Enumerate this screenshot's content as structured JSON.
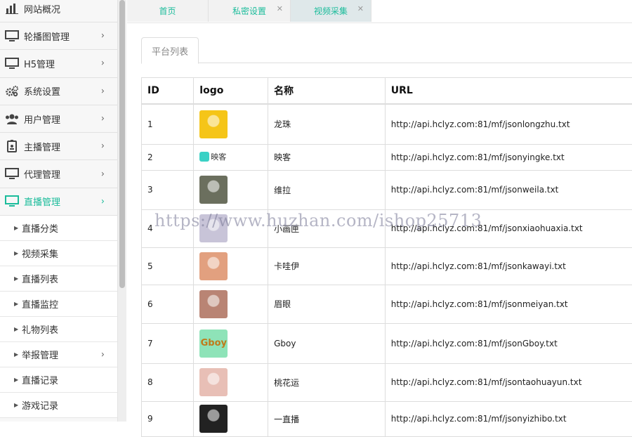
{
  "sidebar": {
    "items": [
      {
        "label": "网站概况",
        "icon": "bar-chart-icon",
        "has_arrow": false
      },
      {
        "label": "轮播图管理",
        "icon": "monitor-icon",
        "has_arrow": true
      },
      {
        "label": "H5管理",
        "icon": "monitor-icon",
        "has_arrow": true
      },
      {
        "label": "系统设置",
        "icon": "gears-icon",
        "has_arrow": true
      },
      {
        "label": "用户管理",
        "icon": "users-icon",
        "has_arrow": true
      },
      {
        "label": "主播管理",
        "icon": "id-badge-icon",
        "has_arrow": true
      },
      {
        "label": "代理管理",
        "icon": "monitor-icon",
        "has_arrow": true
      },
      {
        "label": "直播管理",
        "icon": "monitor-icon",
        "has_arrow": true,
        "active": true
      }
    ],
    "sub_items": [
      {
        "label": "直播分类",
        "has_arrow": false
      },
      {
        "label": "视频采集",
        "has_arrow": false
      },
      {
        "label": "直播列表",
        "has_arrow": false
      },
      {
        "label": "直播监控",
        "has_arrow": false
      },
      {
        "label": "礼物列表",
        "has_arrow": false
      },
      {
        "label": "举报管理",
        "has_arrow": true
      },
      {
        "label": "直播记录",
        "has_arrow": false
      },
      {
        "label": "游戏记录",
        "has_arrow": false
      }
    ],
    "arrow": "›",
    "subarrow": "▸"
  },
  "tabs": [
    {
      "label": "首页",
      "closable": false
    },
    {
      "label": "私密设置",
      "closable": true
    },
    {
      "label": "视频采集",
      "closable": true
    }
  ],
  "close_glyph": "✕",
  "subtab": {
    "label": "平台列表"
  },
  "table": {
    "headers": [
      "ID",
      "logo",
      "名称",
      "URL"
    ],
    "rows": [
      {
        "id": "1",
        "name": "龙珠",
        "url": "http://api.hclyz.com:81/mf/jsonlongzhu.txt",
        "logo_color": "#f5c518"
      },
      {
        "id": "2",
        "name": "映客",
        "url": "http://api.hclyz.com:81/mf/jsonyingke.txt",
        "logo_color": "#3ad1c5",
        "logo_text": "映客"
      },
      {
        "id": "3",
        "name": "维拉",
        "url": "http://api.hclyz.com:81/mf/jsonweila.txt",
        "logo_color": "#6b6f5e"
      },
      {
        "id": "4",
        "name": "小画匣",
        "url": "http://api.hclyz.com:81/mf/jsonxiaohuaxia.txt",
        "logo_color": "#c8c4d8"
      },
      {
        "id": "5",
        "name": "卡哇伊",
        "url": "http://api.hclyz.com:81/mf/jsonkawayi.txt",
        "logo_color": "#e2a07f"
      },
      {
        "id": "6",
        "name": "眉眼",
        "url": "http://api.hclyz.com:81/mf/jsonmeiyan.txt",
        "logo_color": "#b98474"
      },
      {
        "id": "7",
        "name": "Gboy",
        "url": "http://api.hclyz.com:81/mf/jsonGboy.txt",
        "logo_color": "#8ee3b8",
        "logo_text": "Gboy"
      },
      {
        "id": "8",
        "name": "桃花运",
        "url": "http://api.hclyz.com:81/mf/jsontaohuayun.txt",
        "logo_color": "#e8bfb6"
      },
      {
        "id": "9",
        "name": "一直播",
        "url": "http://api.hclyz.com:81/mf/jsonyizhibo.txt",
        "logo_color": "#222222"
      }
    ]
  },
  "watermark": "https://www.huzhan.com/ishop25713",
  "colors": {
    "accent": "#1bbc9b"
  }
}
